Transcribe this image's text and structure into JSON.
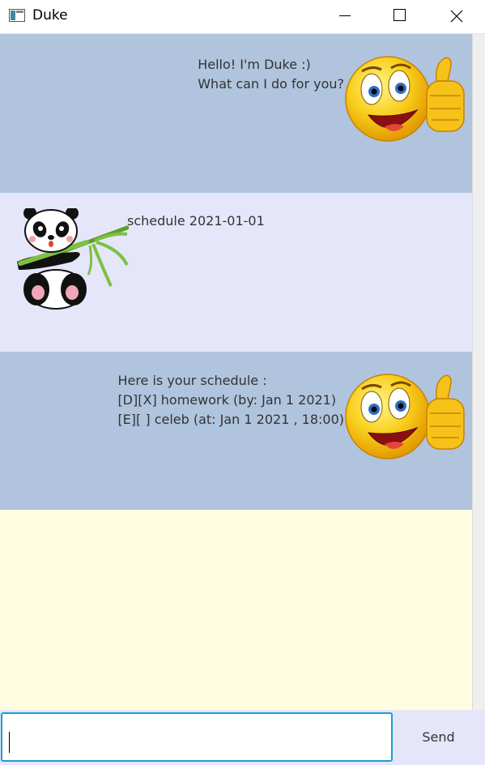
{
  "window": {
    "title": "Duke",
    "icon": "app-window-icon"
  },
  "colors": {
    "duke_row": "#b0c4de",
    "user_row": "#e6e6fa",
    "chat_background": "#fffde0",
    "input_border": "#1aa0cf",
    "input_bar": "#e6e6fa"
  },
  "messages": [
    {
      "sender": "duke",
      "avatar": "thumbs-up-smiley-icon",
      "text": "Hello! I'm Duke :)\nWhat can I do for you?"
    },
    {
      "sender": "user",
      "avatar": "panda-with-bamboo-icon",
      "text": "schedule 2021-01-01"
    },
    {
      "sender": "duke",
      "avatar": "thumbs-up-smiley-icon",
      "text": "Here is your schedule :\n[D][X] homework (by: Jan 1 2021)\n[E][ ] celeb (at: Jan 1 2021 , 18:00)"
    }
  ],
  "input": {
    "value": "",
    "placeholder": ""
  },
  "send_label": "Send"
}
